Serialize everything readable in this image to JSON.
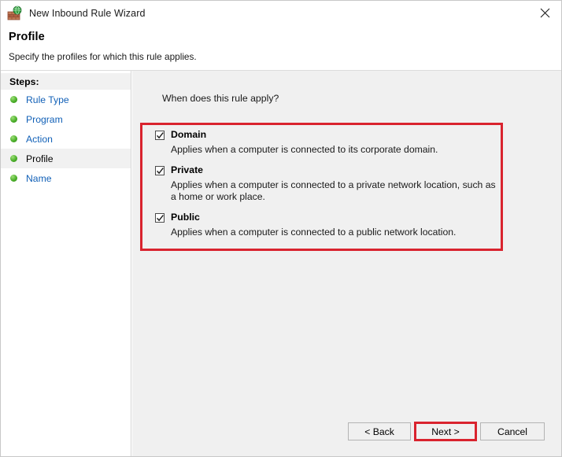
{
  "window": {
    "title": "New Inbound Rule Wizard",
    "icon": "firewall-icon",
    "close_label": "✕"
  },
  "header": {
    "title": "Profile",
    "subtitle": "Specify the profiles for which this rule applies."
  },
  "sidebar": {
    "heading": "Steps:",
    "items": [
      {
        "label": "Rule Type",
        "current": false
      },
      {
        "label": "Program",
        "current": false
      },
      {
        "label": "Action",
        "current": false
      },
      {
        "label": "Profile",
        "current": true
      },
      {
        "label": "Name",
        "current": false
      }
    ]
  },
  "main": {
    "prompt": "When does this rule apply?",
    "profiles": [
      {
        "name": "Domain",
        "description": "Applies when a computer is connected to its corporate domain.",
        "checked": true
      },
      {
        "name": "Private",
        "description": "Applies when a computer is connected to a private network location, such as a home or work place.",
        "checked": true
      },
      {
        "name": "Public",
        "description": "Applies when a computer is connected to a public network location.",
        "checked": true
      }
    ]
  },
  "footer": {
    "back_label": "< Back",
    "next_label": "Next >",
    "cancel_label": "Cancel"
  },
  "annotations": {
    "accent_color": "#d9232e",
    "profiles_box": "highlight-profile-checkboxes",
    "next_box": "highlight-next-button"
  },
  "colors": {
    "link": "#1160b7",
    "content_bg": "#f0f0f0",
    "titlebar_bg": "#ffffff",
    "step_bullet": "#4caf2a"
  }
}
